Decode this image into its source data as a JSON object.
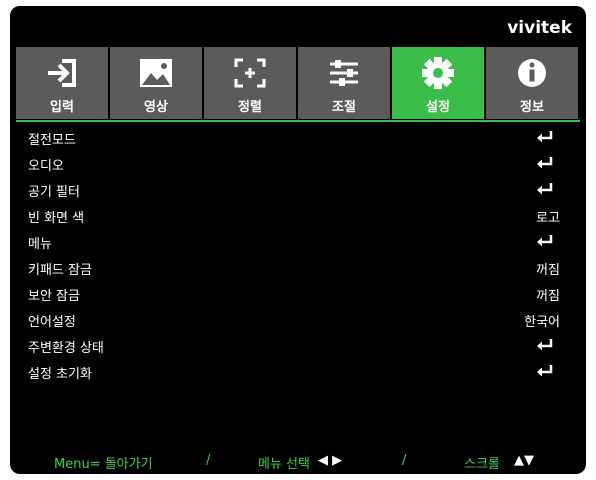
{
  "brand": {
    "logo": "vivitek"
  },
  "tabs": [
    {
      "label": "입력",
      "icon": "input-icon",
      "active": false
    },
    {
      "label": "영상",
      "icon": "image-icon",
      "active": false
    },
    {
      "label": "정렬",
      "icon": "align-icon",
      "active": false
    },
    {
      "label": "조절",
      "icon": "sliders-icon",
      "active": false
    },
    {
      "label": "설정",
      "icon": "gear-icon",
      "active": true
    },
    {
      "label": "정보",
      "icon": "info-icon",
      "active": false
    }
  ],
  "menu": {
    "items": [
      {
        "label": "절전모드",
        "value": "",
        "enter": true
      },
      {
        "label": "오디오",
        "value": "",
        "enter": true
      },
      {
        "label": "공기 필터",
        "value": "",
        "enter": true
      },
      {
        "label": "빈 화면 색",
        "value": "로고",
        "enter": false
      },
      {
        "label": "메뉴",
        "value": "",
        "enter": true
      },
      {
        "label": "키패드 잠금",
        "value": "꺼짐",
        "enter": false
      },
      {
        "label": "보안 잠금",
        "value": "꺼짐",
        "enter": false
      },
      {
        "label": "언어설정",
        "value": "한국어",
        "enter": false
      },
      {
        "label": "주변환경 상태",
        "value": "",
        "enter": true
      },
      {
        "label": "설정 초기화",
        "value": "",
        "enter": true
      }
    ]
  },
  "footer": {
    "back": "Menu= 돌아가기",
    "slash1": "/",
    "select": "메뉴 선택",
    "select_arrows": "◀ ▶",
    "slash2": "/",
    "scroll": "스크롤",
    "scroll_arrows": "▲▼"
  },
  "colors": {
    "accent": "#3bbd4a",
    "tab_bg": "#5b5b5b",
    "background": "#000000",
    "footer_text": "#38d24a"
  }
}
